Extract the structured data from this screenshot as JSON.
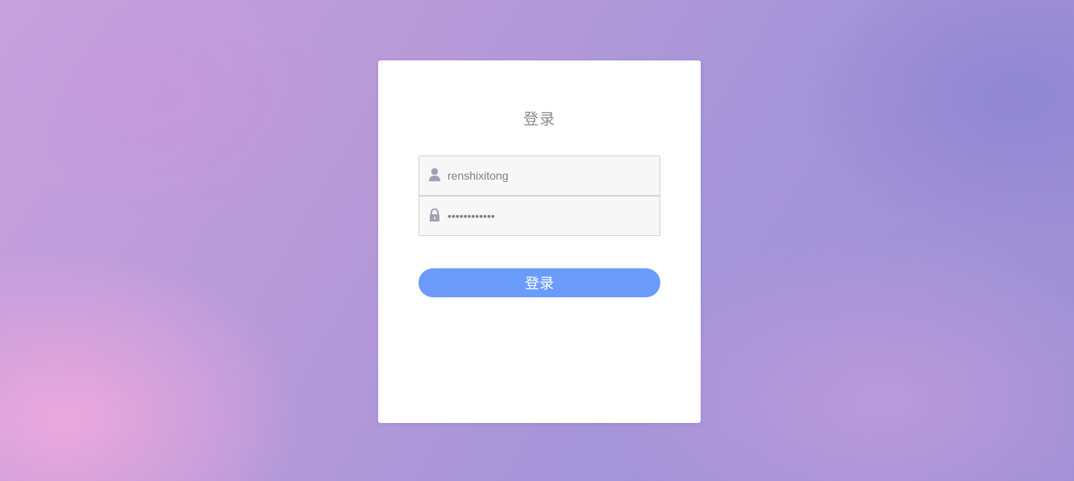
{
  "login": {
    "title": "登录",
    "username": {
      "value": "renshixitong",
      "icon": "user-icon"
    },
    "password": {
      "value": "••••••••••••",
      "icon": "lock-icon"
    },
    "submit_label": "登录"
  },
  "colors": {
    "button": "#6b9cfc",
    "card": "#ffffff",
    "field_background": "#f7f7f7",
    "icon": "#a79fb3",
    "background_start": "#c6a0dc",
    "background_end": "#9b8fd4"
  }
}
